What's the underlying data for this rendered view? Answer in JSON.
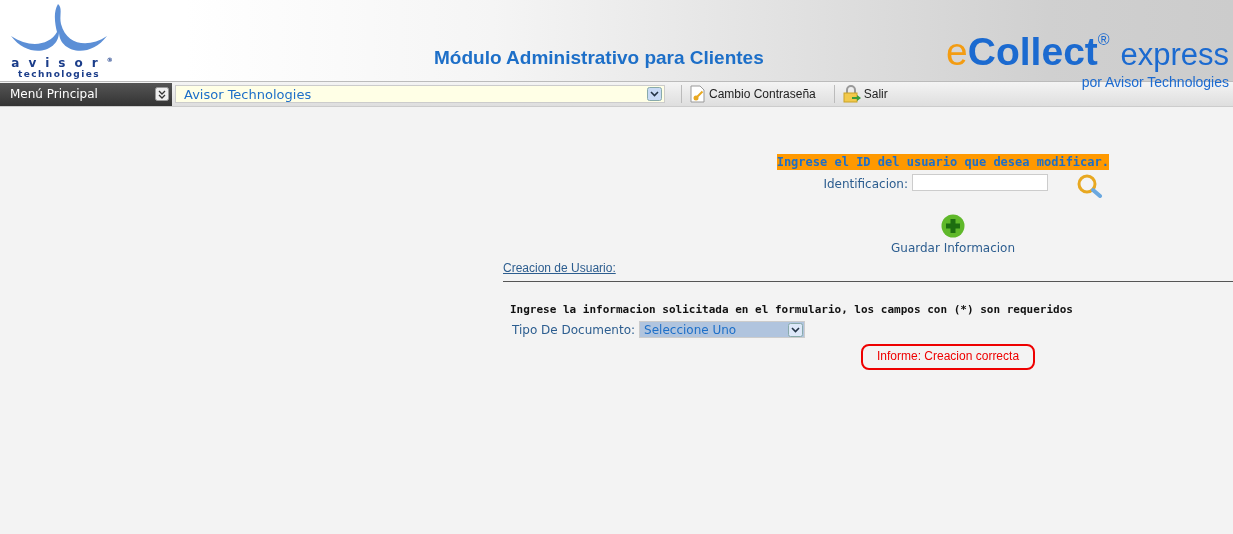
{
  "header": {
    "logo": {
      "name": "avisor",
      "mark": "®",
      "tagline": "technologies"
    },
    "title": "Módulo Administrativo para Clientes",
    "brand": {
      "prefix": "e",
      "name": "Collect",
      "mark": "®",
      "suffix": "express",
      "byline": "por Avisor Technologies"
    }
  },
  "toolbar": {
    "main_menu": "Menú Principal",
    "company_select": {
      "value": "Avisor Technologies"
    },
    "actions": [
      {
        "kind": "password",
        "label": "Cambio Contraseña"
      },
      {
        "kind": "exit",
        "label": "Salir"
      }
    ]
  },
  "search": {
    "heading": "Ingrese el ID del usuario que desea modificar.",
    "field_label": "Identificacion:"
  },
  "save_label": "Guardar Informacion",
  "section_link": "Creacion de Usuario:",
  "form": {
    "instructions": "Ingrese la informacion solicitada en el formulario, los campos con (*) son requeridos",
    "document_type": {
      "label": "Tipo De Documento:",
      "value": "Seleccione Uno"
    }
  },
  "message": "Informe: Creacion correcta"
}
